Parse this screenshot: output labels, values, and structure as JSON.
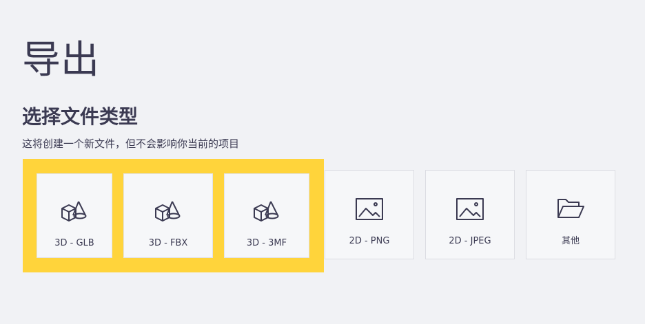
{
  "page": {
    "title": "导出",
    "section_title": "选择文件类型",
    "description": "这将创建一个新文件，但不会影响你当前的项目"
  },
  "file_types": [
    {
      "label": "3D - GLB",
      "icon": "3d-shapes-icon",
      "selected": true
    },
    {
      "label": "3D - FBX",
      "icon": "3d-shapes-icon",
      "selected": true
    },
    {
      "label": "3D - 3MF",
      "icon": "3d-shapes-icon",
      "selected": true
    },
    {
      "label": "2D - PNG",
      "icon": "image-icon",
      "selected": false
    },
    {
      "label": "2D - JPEG",
      "icon": "image-icon",
      "selected": false
    },
    {
      "label": "其他",
      "icon": "folder-open-icon",
      "selected": false
    }
  ],
  "colors": {
    "highlight": "#ffd43b",
    "text": "#3b3a52",
    "background": "#f1f2f5",
    "card_background": "#f6f7f9",
    "card_border": "#dcdde3"
  }
}
